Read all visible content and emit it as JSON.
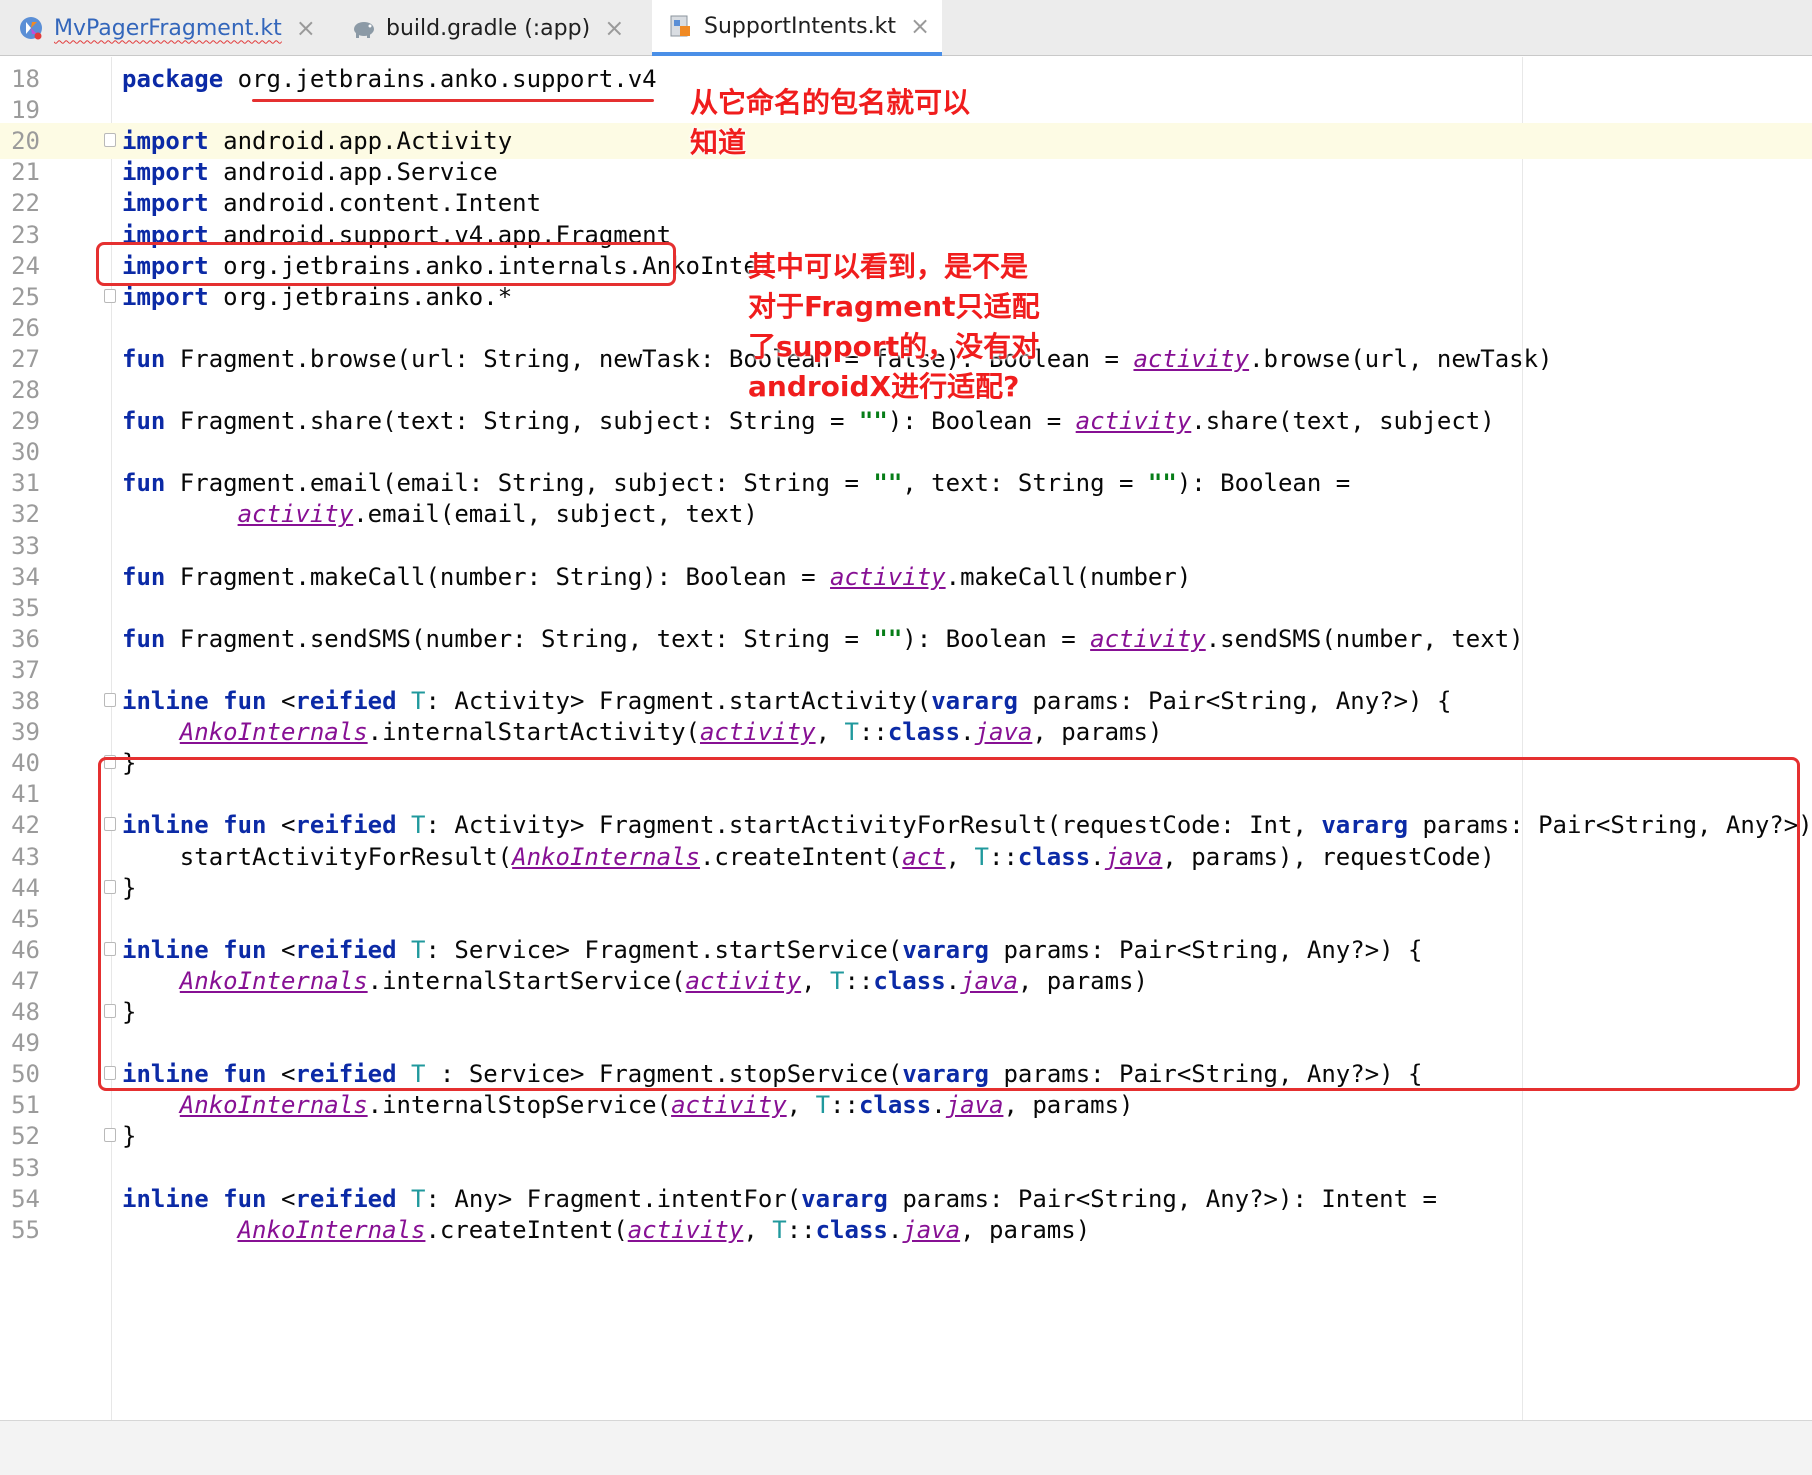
{
  "tabs": [
    {
      "label": "MvPagerFragment.kt",
      "icon": "kotlin-file-icon",
      "state": "error"
    },
    {
      "label": "build.gradle (:app)",
      "icon": "gradle-elephant-icon",
      "state": "normal"
    },
    {
      "label": "SupportIntents.kt",
      "icon": "kotlin-support-file-icon",
      "state": "active"
    }
  ],
  "tab_close_glyph": "×",
  "colors": {
    "keyword": "#0b2aa6",
    "type_param": "#20999d",
    "italic_ref": "#871094",
    "string": "#067d17",
    "annotation_red": "#e53030",
    "current_line_bg": "#fdfbe4"
  },
  "code_lines": [
    {
      "n": "18",
      "text": "package org.jetbrains.anko.support.v4"
    },
    {
      "n": "19",
      "text": ""
    },
    {
      "n": "20",
      "text": "import android.app.Activity"
    },
    {
      "n": "21",
      "text": "import android.app.Service"
    },
    {
      "n": "22",
      "text": "import android.content.Intent"
    },
    {
      "n": "23",
      "text": "import android.support.v4.app.Fragment"
    },
    {
      "n": "24",
      "text": "import org.jetbrains.anko.internals.AnkoInter"
    },
    {
      "n": "25",
      "text": "import org.jetbrains.anko.*"
    },
    {
      "n": "26",
      "text": ""
    },
    {
      "n": "27",
      "text": "fun Fragment.browse(url: String, newTask: Boolean = false): Boolean = activity.browse(url, newTask)"
    },
    {
      "n": "28",
      "text": ""
    },
    {
      "n": "29",
      "text": "fun Fragment.share(text: String, subject: String = \"\"): Boolean = activity.share(text, subject)"
    },
    {
      "n": "30",
      "text": ""
    },
    {
      "n": "31",
      "text": "fun Fragment.email(email: String, subject: String = \"\", text: String = \"\"): Boolean ="
    },
    {
      "n": "32",
      "text": "        activity.email(email, subject, text)"
    },
    {
      "n": "33",
      "text": ""
    },
    {
      "n": "34",
      "text": "fun Fragment.makeCall(number: String): Boolean = activity.makeCall(number)"
    },
    {
      "n": "35",
      "text": ""
    },
    {
      "n": "36",
      "text": "fun Fragment.sendSMS(number: String, text: String = \"\"): Boolean = activity.sendSMS(number, text)"
    },
    {
      "n": "37",
      "text": ""
    },
    {
      "n": "38",
      "text": "inline fun <reified T: Activity> Fragment.startActivity(vararg params: Pair<String, Any?>) {"
    },
    {
      "n": "39",
      "text": "    AnkoInternals.internalStartActivity(activity, T::class.java, params)"
    },
    {
      "n": "40",
      "text": "}"
    },
    {
      "n": "41",
      "text": ""
    },
    {
      "n": "42",
      "text": "inline fun <reified T: Activity> Fragment.startActivityForResult(requestCode: Int, vararg params: Pair<String, Any?>) {"
    },
    {
      "n": "43",
      "text": "    startActivityForResult(AnkoInternals.createIntent(act, T::class.java, params), requestCode)"
    },
    {
      "n": "44",
      "text": "}"
    },
    {
      "n": "45",
      "text": ""
    },
    {
      "n": "46",
      "text": "inline fun <reified T: Service> Fragment.startService(vararg params: Pair<String, Any?>) {"
    },
    {
      "n": "47",
      "text": "    AnkoInternals.internalStartService(activity, T::class.java, params)"
    },
    {
      "n": "48",
      "text": "}"
    },
    {
      "n": "49",
      "text": ""
    },
    {
      "n": "50",
      "text": "inline fun <reified T : Service> Fragment.stopService(vararg params: Pair<String, Any?>) {"
    },
    {
      "n": "51",
      "text": "    AnkoInternals.internalStopService(activity, T::class.java, params)"
    },
    {
      "n": "52",
      "text": "}"
    },
    {
      "n": "53",
      "text": ""
    },
    {
      "n": "54",
      "text": "inline fun <reified T: Any> Fragment.intentFor(vararg params: Pair<String, Any?>): Intent ="
    },
    {
      "n": "55",
      "text": "        AnkoInternals.createIntent(activity, T::class.java, params)"
    }
  ],
  "annotations": {
    "note_package": "从它命名的包名就可以\n知道",
    "note_fragment": "其中可以看到，是不是\n对于Fragment只适配\n了support的，没有对\nandroidX进行适配?"
  }
}
